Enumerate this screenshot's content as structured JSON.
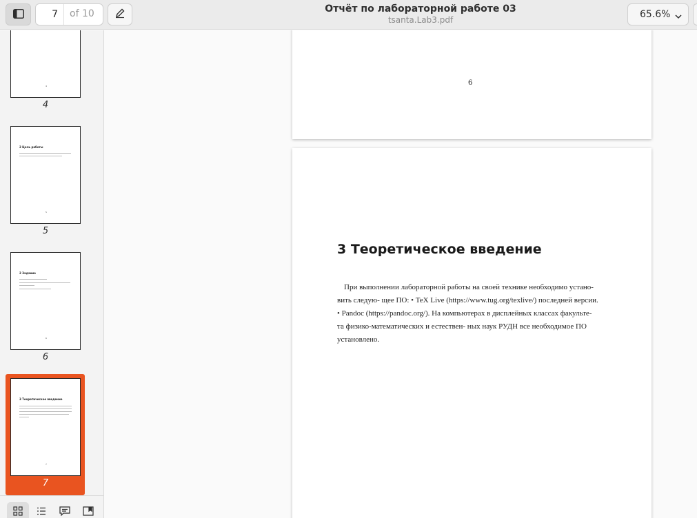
{
  "header": {
    "title": "Отчёт по лабораторной работе 03",
    "filename": "tsanta.Lab3.pdf",
    "current_page": "7",
    "page_total_label": "of 10",
    "zoom": "65.6%"
  },
  "sidebar": {
    "thumbnails": [
      {
        "label": "4",
        "heading": "",
        "selected": false
      },
      {
        "label": "5",
        "heading": "2 Цель работы",
        "selected": false
      },
      {
        "label": "6",
        "heading": "2 Задание",
        "selected": false
      },
      {
        "label": "7",
        "heading": "3 Теоретическое введение",
        "selected": true
      }
    ],
    "footer_buttons": [
      "grid-view",
      "outline",
      "annotations",
      "bookmarks"
    ]
  },
  "document": {
    "page6_number": "6",
    "page7": {
      "heading": "3  Теоретическое введение",
      "lines": [
        "При выполнении лабораторной работы на своей технике необходимо устано-",
        "вить следую- щее ПО: • TeX Live (https://www.tug.org/texlive/) последней версии.",
        "• Pandoc (https://pandoc.org/). На компьютерах в дисплейных классах факульте-",
        "та физико-математических и естествен- ных наук РУДН все необходимое ПО",
        "установлено."
      ]
    }
  },
  "colors": {
    "accent": "#e95420",
    "header_bg": "#ebebeb",
    "sidebar_bg": "#f3f3f3"
  }
}
